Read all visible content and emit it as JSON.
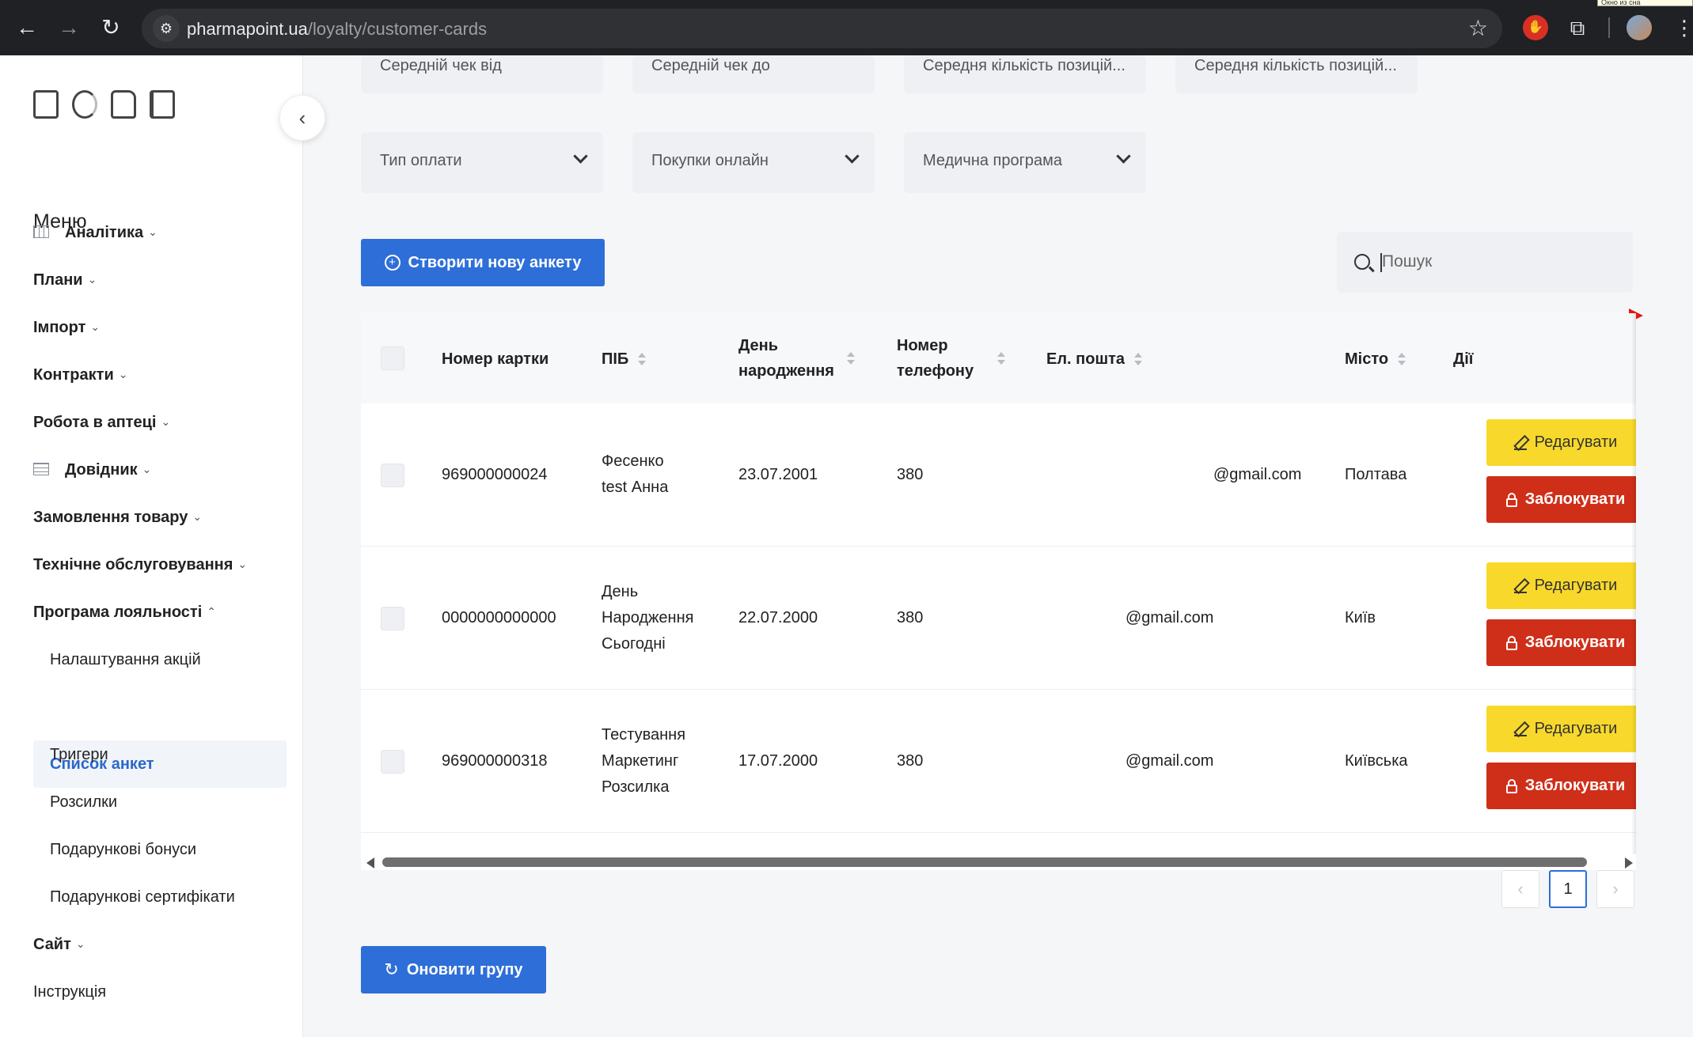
{
  "browser": {
    "url_host": "pharmapoint.ua",
    "url_path": "/loyalty/customer-cards",
    "tooltip": "Окно из сна"
  },
  "sidebar": {
    "menu_title": "Меню",
    "items": [
      {
        "label": "Аналітика"
      },
      {
        "label": "Плани"
      },
      {
        "label": "Імпорт"
      },
      {
        "label": "Контракти"
      },
      {
        "label": "Робота в аптеці"
      },
      {
        "label": "Довідник"
      },
      {
        "label": "Замовлення товару"
      },
      {
        "label": "Технічне обслуговування"
      },
      {
        "label": "Програма лояльності"
      }
    ],
    "sub_items": [
      {
        "label": "Налаштування акцій"
      },
      {
        "label": "Список анкет"
      },
      {
        "label": "Тригери"
      },
      {
        "label": "Розсилки"
      },
      {
        "label": "Подарункові бонуси"
      },
      {
        "label": "Подарункові сертифікати"
      }
    ],
    "site_label": "Сайт",
    "instruction_label": "Інструкція"
  },
  "filters": {
    "row1": [
      "Середній чек від",
      "Середній чек до",
      "Середня кількість позицій...",
      "Середня кількість позицій..."
    ],
    "row2": [
      "Тип оплати",
      "Покупки онлайн",
      "Медична програма"
    ]
  },
  "actions": {
    "create_label": "Створити нову анкету",
    "refresh_label": "Оновити групу"
  },
  "search": {
    "placeholder": "Пошук"
  },
  "table": {
    "columns": [
      "Номер картки",
      "ПІБ",
      "День народження",
      "Номер телефону",
      "Ел. пошта",
      "Місто",
      "Дії"
    ],
    "col_birthday_1": "День",
    "col_birthday_2": "народження",
    "col_phone_1": "Номер",
    "col_phone_2": "телефону",
    "rows": [
      {
        "card": "969000000024",
        "name_1": "Фесенко",
        "name_2": "test Анна",
        "name_3": "",
        "birthday": "23.07.2001",
        "phone": "380",
        "email": "@gmail.com",
        "city": "Полтава"
      },
      {
        "card": "0000000000000",
        "name_1": "День",
        "name_2": "Народження",
        "name_3": "Сьогодні",
        "birthday": "22.07.2000",
        "phone": "380",
        "email": "@gmail.com",
        "city": "Київ"
      },
      {
        "card": "969000000318",
        "name_1": "Тестування",
        "name_2": "Маркетинг",
        "name_3": "Розсилка",
        "birthday": "17.07.2000",
        "phone": "380",
        "email": "@gmail.com",
        "city": "Київська"
      }
    ],
    "edit_label": "Редагувати",
    "block_label": "Заблокувати"
  },
  "pagination": {
    "prev": "‹",
    "current": "1",
    "next": "›"
  }
}
